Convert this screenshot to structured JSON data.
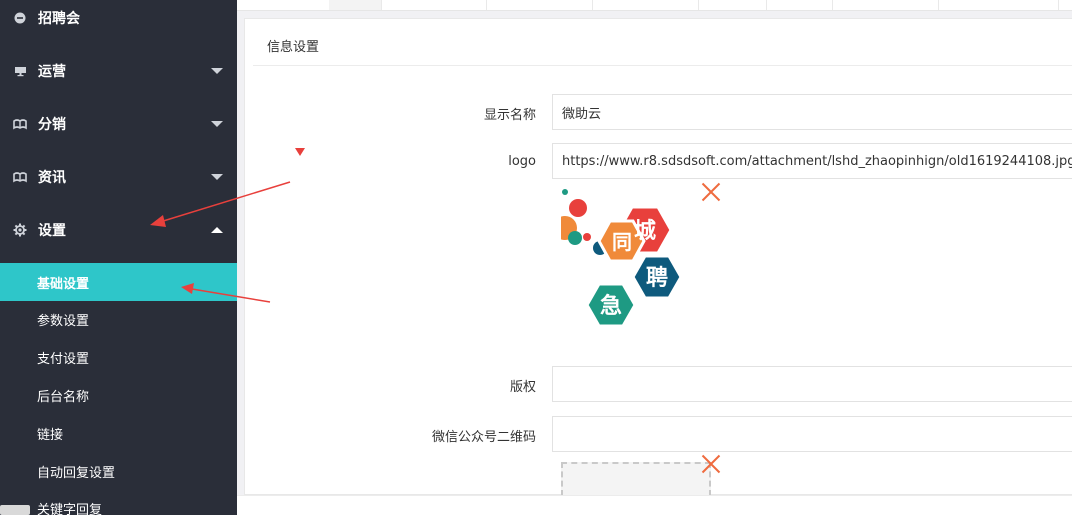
{
  "sidebar": {
    "items": [
      {
        "label": "招聘会",
        "icon": "circle-icon"
      },
      {
        "label": "运营",
        "icon": "monitor-icon"
      },
      {
        "label": "分销",
        "icon": "book-icon"
      },
      {
        "label": "资讯",
        "icon": "book-icon"
      },
      {
        "label": "设置",
        "icon": "gear-icon"
      }
    ],
    "sub_items": [
      {
        "label": "基础设置"
      },
      {
        "label": "参数设置"
      },
      {
        "label": "支付设置"
      },
      {
        "label": "后台名称"
      },
      {
        "label": "链接"
      },
      {
        "label": "自动回复设置"
      },
      {
        "label": "关键字回复"
      }
    ],
    "active_sub": "基础设置"
  },
  "panel": {
    "title": "信息设置"
  },
  "form": {
    "display_name_label": "显示名称",
    "display_name_value": "微助云",
    "logo_label": "logo",
    "logo_value": "https://www.r8.sdsdsoft.com/attachment/lshd_zhaopinhign/old1619244108.jpg",
    "copyright_label": "版权",
    "copyright_value": "",
    "wechat_qr_label": "微信公众号二维码",
    "wechat_qr_value": ""
  },
  "logo_image": {
    "chars": [
      "城",
      "同",
      "聘",
      "急"
    ]
  },
  "colors": {
    "sidebar_bg": "#2a2e39",
    "active_accent": "#2ec6c9",
    "annotation_red": "#e8403c",
    "close_orange": "#ef6b3f"
  }
}
